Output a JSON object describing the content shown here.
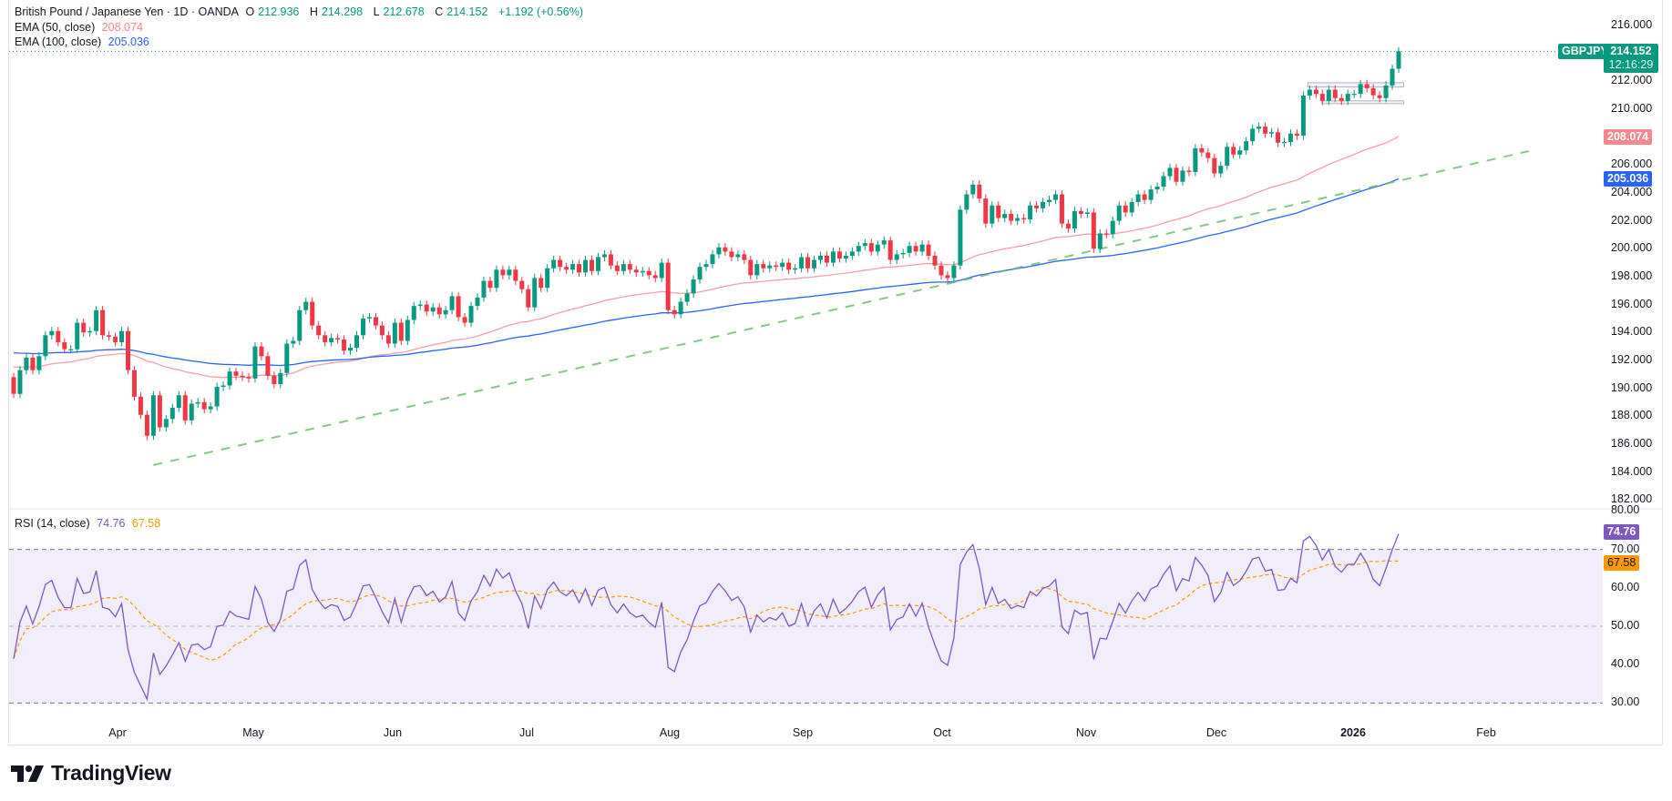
{
  "header": {
    "symbol_name": "British Pound / Japanese Yen · 1D · OANDA",
    "open_label": "O",
    "open": "212.936",
    "high_label": "H",
    "high": "214.298",
    "low_label": "L",
    "low": "212.678",
    "close_label": "C",
    "close": "214.152",
    "change": "+1.192 (+0.56%)"
  },
  "indicators": {
    "ema50": {
      "label": "EMA (50, close)",
      "value": "208.074",
      "color": "#f7525f"
    },
    "ema100": {
      "label": "EMA (100, close)",
      "value": "205.036",
      "color": "#2962ff"
    },
    "rsi": {
      "label": "RSI (14, close)",
      "value": "74.76",
      "ma_value": "67.58",
      "color": "#7e57c2",
      "ma_color": "#ff9800"
    }
  },
  "price_badges": {
    "ticker": "GBPJPY",
    "last_price": "214.152",
    "countdown": "12:16:29"
  },
  "colors": {
    "up": "#089981",
    "down": "#f23645",
    "trendline": "#66bb6a",
    "range_box": "#b2b5be"
  },
  "chart_data": {
    "type": "candlestick",
    "interval": "1D",
    "first_open": 190.8,
    "close": [
      189.6,
      191.3,
      192.2,
      191.3,
      192.3,
      193.8,
      194.1,
      193.3,
      192.8,
      192.8,
      194.7,
      194.0,
      194.1,
      195.6,
      193.8,
      193.7,
      193.3,
      194.1,
      191.3,
      189.4,
      188.1,
      186.6,
      189.5,
      187.2,
      187.8,
      188.6,
      189.5,
      187.7,
      188.9,
      189.0,
      188.5,
      188.7,
      190.1,
      190.2,
      191.2,
      190.9,
      190.8,
      190.7,
      193.0,
      192.3,
      190.9,
      190.3,
      191.1,
      193.2,
      193.4,
      195.6,
      196.2,
      194.5,
      193.8,
      193.3,
      193.6,
      193.5,
      192.7,
      192.9,
      193.8,
      195.0,
      195.1,
      194.5,
      193.8,
      193.2,
      194.7,
      193.4,
      194.9,
      195.9,
      196.0,
      195.5,
      195.8,
      195.3,
      195.6,
      196.6,
      195.1,
      194.7,
      195.9,
      196.5,
      197.7,
      197.2,
      198.5,
      198.1,
      198.5,
      197.7,
      197.1,
      195.8,
      197.9,
      197.2,
      198.6,
      199.2,
      198.7,
      198.5,
      198.9,
      198.3,
      199.2,
      198.4,
      199.4,
      199.6,
      198.8,
      198.4,
      198.9,
      198.5,
      198.3,
      198.4,
      198.1,
      197.9,
      199.0,
      195.6,
      195.3,
      196.2,
      196.8,
      197.8,
      198.7,
      198.9,
      199.6,
      200.1,
      199.8,
      199.4,
      199.6,
      199.2,
      198.1,
      198.9,
      198.6,
      198.8,
      198.7,
      199.0,
      198.5,
      198.6,
      199.4,
      198.6,
      199.2,
      199.5,
      199.0,
      199.8,
      199.3,
      199.5,
      199.8,
      200.2,
      200.4,
      199.8,
      200.3,
      200.6,
      199.2,
      199.6,
      199.7,
      200.2,
      199.8,
      200.3,
      199.5,
      198.8,
      198.1,
      197.9,
      198.8,
      202.8,
      203.9,
      204.6,
      203.6,
      201.8,
      203.1,
      202.2,
      202.5,
      202.0,
      202.2,
      202.1,
      203.1,
      202.9,
      203.35,
      203.5,
      203.9,
      201.8,
      201.45,
      202.7,
      202.5,
      202.6,
      200.0,
      201.1,
      201.05,
      202.0,
      203.1,
      202.6,
      203.35,
      203.9,
      203.5,
      204.25,
      204.45,
      205.2,
      205.8,
      204.8,
      205.6,
      205.5,
      207.2,
      206.9,
      206.5,
      205.4,
      205.95,
      207.3,
      206.75,
      207.05,
      207.7,
      208.6,
      208.75,
      208.25,
      208.35,
      207.6,
      207.65,
      208.25,
      208.1,
      210.98,
      211.4,
      211.1,
      210.6,
      211.4,
      210.8,
      210.6,
      211.1,
      211.1,
      211.8,
      211.5,
      211.0,
      210.8,
      211.7,
      212.9,
      214.152
    ],
    "ylim": [
      182,
      216
    ],
    "y_tick_labels": [
      "216.000",
      "212.000",
      "210.000",
      "206.000",
      "204.000",
      "202.000",
      "200.000",
      "198.000",
      "196.000",
      "194.000",
      "192.000",
      "190.000",
      "188.000",
      "186.000",
      "184.000",
      "182.000"
    ],
    "x_tick_labels": [
      "Apr",
      "May",
      "Jun",
      "Jul",
      "Aug",
      "Sep",
      "Oct",
      "Nov",
      "Dec",
      "2026",
      "Feb"
    ],
    "ema50_first": 191.6,
    "ema100_first": 192.6,
    "trendline": {
      "from": [
        22,
        184.5
      ],
      "to": [
        238.5,
        207.0
      ],
      "style": "dashed"
    },
    "range_boxes": [
      {
        "from": 203.7,
        "to": 218.8,
        "top": 211.9,
        "bottom": 211.6
      },
      {
        "from": 205.9,
        "to": 218.8,
        "top": 210.6,
        "bottom": 210.4
      }
    ],
    "rsi": {
      "ylim": [
        30,
        80
      ],
      "tick_labels": [
        "80.00",
        "70.00",
        "60.00",
        "50.00",
        "40.00",
        "30.00"
      ],
      "levels": [
        70,
        50,
        30
      ]
    }
  }
}
